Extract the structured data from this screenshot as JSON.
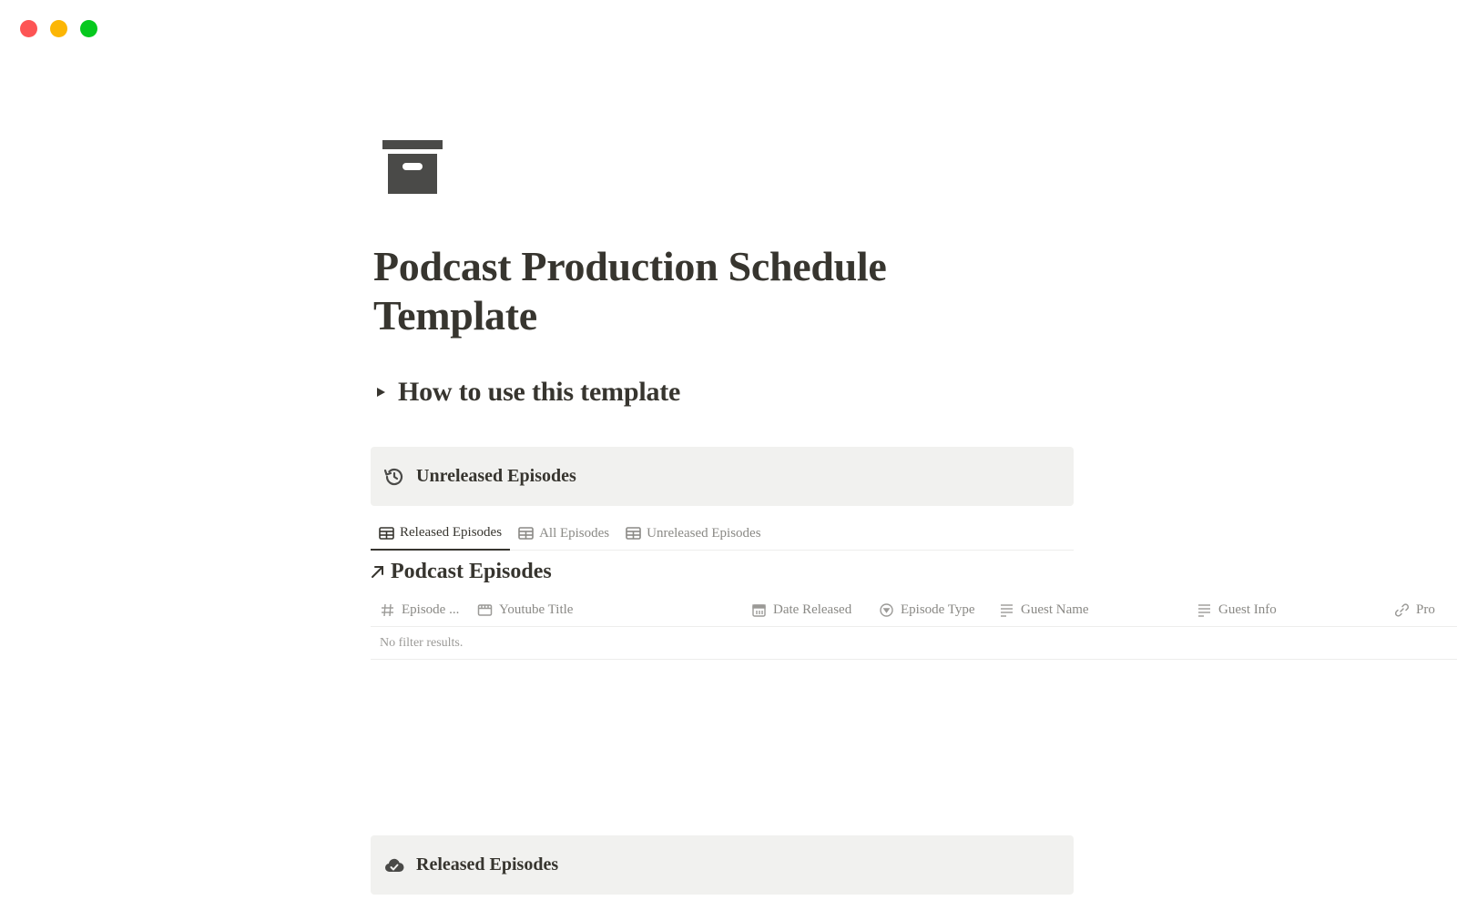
{
  "window": {
    "controls": [
      "close",
      "minimize",
      "maximize"
    ],
    "colors": {
      "close": "#fd5454",
      "minimize": "#fcb604",
      "maximize": "#06c91e"
    }
  },
  "page": {
    "icon": "archive-box-icon",
    "title": "Podcast Production Schedule Template",
    "toggle_label": "How to use this template"
  },
  "callouts": {
    "unreleased": {
      "icon": "history-icon",
      "label": "Unreleased Episodes"
    },
    "released": {
      "icon": "cloud-check-icon",
      "label": "Released Episodes"
    }
  },
  "tabs": [
    {
      "label": "Released Episodes",
      "icon": "table-icon",
      "active": true
    },
    {
      "label": "All Episodes",
      "icon": "table-icon",
      "active": false
    },
    {
      "label": "Unreleased Episodes",
      "icon": "table-icon",
      "active": false
    }
  ],
  "database": {
    "title": "Podcast Episodes",
    "link_icon": "arrow-up-right-icon",
    "columns": [
      {
        "label": "Episode ...",
        "icon": "number-icon"
      },
      {
        "label": "Youtube Title",
        "icon": "title-icon"
      },
      {
        "label": "Date Released",
        "icon": "calendar-icon"
      },
      {
        "label": "Episode Type",
        "icon": "select-icon"
      },
      {
        "label": "Guest Name",
        "icon": "text-icon"
      },
      {
        "label": "Guest Info",
        "icon": "text-icon"
      },
      {
        "label": "Pro",
        "icon": "link-icon"
      }
    ],
    "empty_message": "No filter results."
  }
}
